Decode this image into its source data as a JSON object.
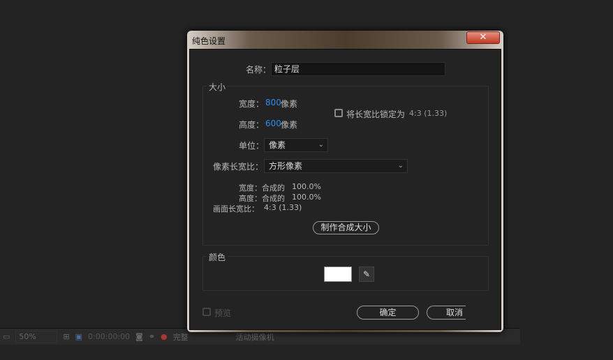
{
  "dialog": {
    "title": "纯色设置",
    "close": "✕",
    "name_label": "名称：",
    "name_value": "粒子层",
    "size_group": "大小",
    "width_label": "宽度：",
    "width_value": "800",
    "width_unit": "像素",
    "height_label": "高度：",
    "height_value": "600",
    "height_unit": "像素",
    "lock_label": "将长宽比锁定为",
    "lock_ratio": "4:3 (1.33)",
    "unit_label": "单位：",
    "unit_value": "像素",
    "par_label": "像素长宽比：",
    "par_value": "方形像素",
    "info_width": "宽度：合成的",
    "info_width_val": "100.0%",
    "info_height": "高度：合成的",
    "info_height_val": "100.0%",
    "info_frame": "画面长宽比：",
    "info_frame_val": "4:3 (1.33)",
    "make_comp_size": "制作合成大小",
    "color_group": "颜色",
    "color_value": "#ffffff",
    "preview": "预览",
    "ok": "确定",
    "cancel": "取消"
  },
  "toolbar": {
    "zoom": "50%",
    "timecode": "0:00:00:00",
    "resolution": "完整",
    "camera": "活动摄像机"
  }
}
